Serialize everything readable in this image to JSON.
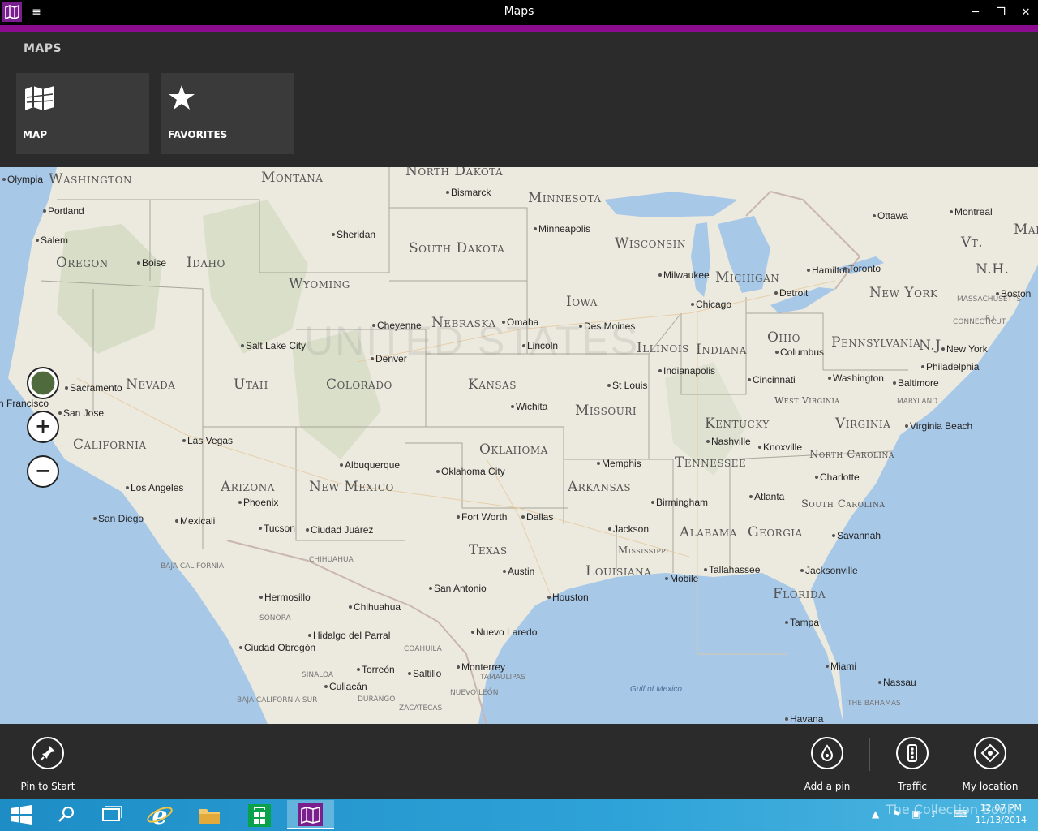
{
  "window": {
    "title": "Maps",
    "controls": {
      "minimize": "─",
      "restore": "❐",
      "close": "✕"
    }
  },
  "nav": {
    "section_title": "MAPS",
    "tiles": [
      {
        "label": "MAP",
        "icon": "map-icon"
      },
      {
        "label": "FAVORITES",
        "icon": "star-icon"
      }
    ]
  },
  "map": {
    "country_label": "UNITED STATES",
    "water_label": "Gulf of Mexico",
    "zoom_in": "+",
    "zoom_out": "−",
    "states": {
      "washington": "Washington",
      "montana": "Montana",
      "north_dakota": "North Dakota",
      "minnesota": "Minnesota",
      "oregon": "Oregon",
      "idaho": "Idaho",
      "wyoming": "Wyoming",
      "south_dakota": "South Dakota",
      "wisconsin": "Wisconsin",
      "michigan": "Michigan",
      "new_york": "New York",
      "vermont": "Vt.",
      "new_hampshire": "N.H.",
      "maine": "Mai",
      "nevada": "Nevada",
      "utah": "Utah",
      "colorado": "Colorado",
      "nebraska": "Nebraska",
      "iowa": "Iowa",
      "illinois": "Illinois",
      "indiana": "Indiana",
      "ohio": "Ohio",
      "pennsylvania": "Pennsylvania",
      "new_jersey": "N.J.",
      "kansas": "Kansas",
      "missouri": "Missouri",
      "kentucky": "Kentucky",
      "west_virginia": "West Virginia",
      "virginia": "Virginia",
      "california": "California",
      "arizona": "Arizona",
      "new_mexico": "New Mexico",
      "oklahoma": "Oklahoma",
      "arkansas": "Arkansas",
      "tennessee": "Tennessee",
      "north_carolina": "North Carolina",
      "south_carolina": "South Carolina",
      "texas": "Texas",
      "louisiana": "Louisiana",
      "mississippi": "Mississippi",
      "alabama": "Alabama",
      "georgia": "Georgia",
      "florida": "Florida",
      "maryland": "Maryland",
      "massachusetts": "Massachusetts",
      "connecticut": "Connecticut",
      "rhode_island": "R.I."
    },
    "mexico": {
      "baja_california": "Baja California",
      "baja_california_sur": "Baja California Sur",
      "sonora": "Sonora",
      "chihuahua_state": "Chihuahua",
      "coahuila": "Coahuila",
      "sinaloa": "Sinaloa",
      "durango": "Durango",
      "nuevo_leon": "Nuevo León",
      "tamaulipas": "Tamaulipas",
      "zacatecas": "Zacatecas",
      "bahamas": "The Bahamas"
    },
    "cities": {
      "olympia": "Olympia",
      "portland": "Portland",
      "salem": "Salem",
      "boise": "Boise",
      "sheridan": "Sheridan",
      "bismarck": "Bismarck",
      "minneapolis": "Minneapolis",
      "milwaukee": "Milwaukee",
      "chicago": "Chicago",
      "detroit": "Detroit",
      "hamilton": "Hamilton",
      "toronto": "Toronto",
      "ottawa": "Ottawa",
      "montreal": "Montreal",
      "boston": "Boston",
      "salt_lake_city": "Salt Lake City",
      "cheyenne": "Cheyenne",
      "omaha": "Omaha",
      "des_moines": "Des Moines",
      "lincoln": "Lincoln",
      "denver": "Denver",
      "columbus": "Columbus",
      "new_york_city": "New York",
      "philadelphia": "Philadelphia",
      "washington_dc": "Washington",
      "baltimore": "Baltimore",
      "indianapolis": "Indianapolis",
      "st_louis": "St Louis",
      "cincinnati": "Cincinnati",
      "sacramento": "Sacramento",
      "san_francisco": "n Francisco",
      "san_jose": "San Jose",
      "las_vegas": "Las Vegas",
      "wichita": "Wichita",
      "nashville": "Nashville",
      "knoxville": "Knoxville",
      "virginia_beach": "Virginia Beach",
      "charlotte": "Charlotte",
      "oklahoma_city": "Oklahoma City",
      "albuquerque": "Albuquerque",
      "memphis": "Memphis",
      "los_angeles": "Los Angeles",
      "phoenix": "Phoenix",
      "san_diego": "San Diego",
      "mexicali": "Mexicali",
      "tucson": "Tucson",
      "ciudad_juarez": "Ciudad Juárez",
      "fort_worth": "Fort Worth",
      "dallas": "Dallas",
      "birmingham": "Birmingham",
      "atlanta": "Atlanta",
      "jackson": "Jackson",
      "savannah": "Savannah",
      "austin": "Austin",
      "san_antonio": "San Antonio",
      "houston": "Houston",
      "mobile": "Mobile",
      "tallahassee": "Tallahassee",
      "jacksonville": "Jacksonville",
      "hermosillo": "Hermosillo",
      "chihuahua": "Chihuahua",
      "hidalgo_del_parral": "Hidalgo del Parral",
      "ciudad_obregon": "Ciudad Obregón",
      "nuevo_laredo": "Nuevo Laredo",
      "torreon": "Torreón",
      "saltillo": "Saltillo",
      "monterrey": "Monterrey",
      "culiacan": "Culiacán",
      "tampa": "Tampa",
      "miami": "Miami",
      "nassau": "Nassau",
      "havana": "Havana"
    }
  },
  "appbar": {
    "pin_to_start": "Pin to Start",
    "add_a_pin": "Add a pin",
    "traffic": "Traffic",
    "my_location": "My location"
  },
  "taskbar": {
    "time": "12:07 PM",
    "date": "11/13/2014",
    "watermark": "The Collection Book"
  },
  "colors": {
    "accent": "#8b0c8e",
    "map_land": "#eceade",
    "map_water": "#a8c8e8",
    "chrome": "#2b2b2b"
  }
}
